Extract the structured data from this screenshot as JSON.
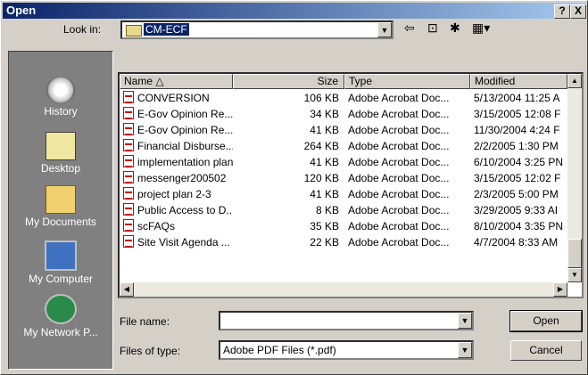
{
  "window": {
    "title": "Open",
    "help_label": "?",
    "close_label": "X"
  },
  "look_in": {
    "label": "Look in:",
    "value": "CM-ECF"
  },
  "places": [
    {
      "label": "History",
      "icon": "history-icon"
    },
    {
      "label": "Desktop",
      "icon": "desktop-icon"
    },
    {
      "label": "My Documents",
      "icon": "my-documents-icon"
    },
    {
      "label": "My Computer",
      "icon": "my-computer-icon"
    },
    {
      "label": "My Network P...",
      "icon": "network-places-icon"
    }
  ],
  "columns": {
    "name": "Name",
    "size": "Size",
    "type": "Type",
    "modified": "Modified"
  },
  "files": [
    {
      "name": "CONVERSION",
      "size": "106 KB",
      "type": "Adobe Acrobat Doc...",
      "modified": "5/13/2004 11:25 A"
    },
    {
      "name": "E-Gov Opinion Re...",
      "size": "34 KB",
      "type": "Adobe Acrobat Doc...",
      "modified": "3/15/2005 12:08 F"
    },
    {
      "name": "E-Gov Opinion Re...",
      "size": "41 KB",
      "type": "Adobe Acrobat Doc...",
      "modified": "11/30/2004 4:24 F"
    },
    {
      "name": "Financial Disburse...",
      "size": "264 KB",
      "type": "Adobe Acrobat Doc...",
      "modified": "2/2/2005 1:30 PM"
    },
    {
      "name": "implementation plan",
      "size": "41 KB",
      "type": "Adobe Acrobat Doc...",
      "modified": "6/10/2004 3:25 PN"
    },
    {
      "name": "messenger200502",
      "size": "120 KB",
      "type": "Adobe Acrobat Doc...",
      "modified": "3/15/2005 12:02 F"
    },
    {
      "name": "project plan 2-3",
      "size": "41 KB",
      "type": "Adobe Acrobat Doc...",
      "modified": "2/3/2005 5:00 PM"
    },
    {
      "name": "Public Access to D...",
      "size": "8 KB",
      "type": "Adobe Acrobat Doc...",
      "modified": "3/29/2005 9:33 AI"
    },
    {
      "name": "scFAQs",
      "size": "35 KB",
      "type": "Adobe Acrobat Doc...",
      "modified": "8/10/2004 3:35 PN"
    },
    {
      "name": "Site Visit Agenda ...",
      "size": "22 KB",
      "type": "Adobe Acrobat Doc...",
      "modified": "4/7/2004 8:33 AM"
    }
  ],
  "file_name": {
    "label": "File name:",
    "value": ""
  },
  "file_type": {
    "label": "Files of type:",
    "value": "Adobe PDF Files (*.pdf)"
  },
  "buttons": {
    "open": "Open",
    "cancel": "Cancel"
  }
}
